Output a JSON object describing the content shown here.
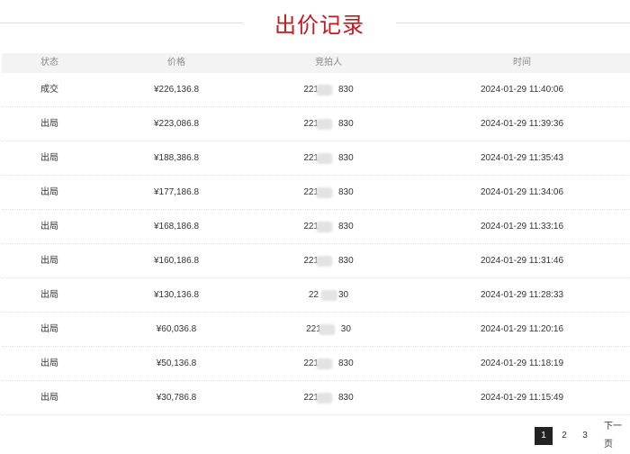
{
  "title": "出价记录",
  "columns": {
    "status": "状态",
    "price": "价格",
    "bidder": "竞拍人",
    "time": "时间"
  },
  "rows": [
    {
      "status": "成交",
      "price": "¥226,136.8",
      "bidder_prefix": "221",
      "bidder_suffix": "830",
      "time": "2024-01-29 11:40:06"
    },
    {
      "status": "出局",
      "price": "¥223,086.8",
      "bidder_prefix": "221",
      "bidder_suffix": "830",
      "time": "2024-01-29 11:39:36"
    },
    {
      "status": "出局",
      "price": "¥188,386.8",
      "bidder_prefix": "221",
      "bidder_suffix": "830",
      "time": "2024-01-29 11:35:43"
    },
    {
      "status": "出局",
      "price": "¥177,186.8",
      "bidder_prefix": "221",
      "bidder_suffix": "830",
      "time": "2024-01-29 11:34:06"
    },
    {
      "status": "出局",
      "price": "¥168,186.8",
      "bidder_prefix": "221",
      "bidder_suffix": "830",
      "time": "2024-01-29 11:33:16"
    },
    {
      "status": "出局",
      "price": "¥160,186.8",
      "bidder_prefix": "221",
      "bidder_suffix": "830",
      "time": "2024-01-29 11:31:46"
    },
    {
      "status": "出局",
      "price": "¥130,136.8",
      "bidder_prefix": "22",
      "bidder_suffix": "30",
      "time": "2024-01-29 11:28:33"
    },
    {
      "status": "出局",
      "price": "¥60,036.8",
      "bidder_prefix": "221",
      "bidder_suffix": "30",
      "time": "2024-01-29 11:20:16"
    },
    {
      "status": "出局",
      "price": "¥50,136.8",
      "bidder_prefix": "221",
      "bidder_suffix": "830",
      "time": "2024-01-29 11:18:19"
    },
    {
      "status": "出局",
      "price": "¥30,786.8",
      "bidder_prefix": "221",
      "bidder_suffix": "830",
      "time": "2024-01-29 11:15:49"
    }
  ],
  "pagination": {
    "pages": [
      "1",
      "2",
      "3"
    ],
    "current": "1",
    "next_label": "下一页"
  },
  "colors": {
    "title": "#c8171e",
    "header_bg": "#f3f3f3",
    "active_page_bg": "#222222"
  }
}
